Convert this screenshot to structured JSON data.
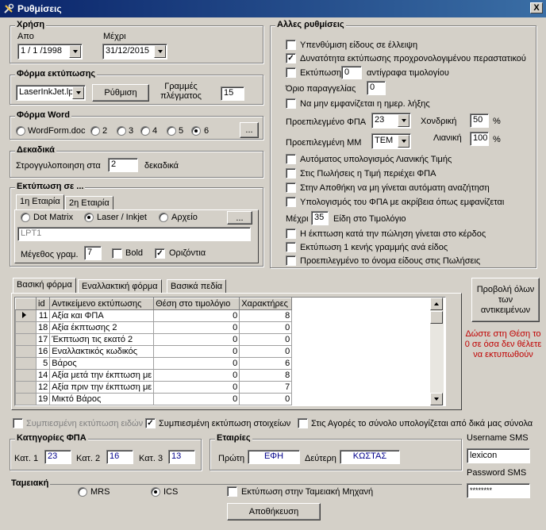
{
  "window": {
    "title": "Ρυθμίσεις",
    "close": "X"
  },
  "xrisi": {
    "title": "Χρήση",
    "from_label": "Απο",
    "to_label": "Μέχρι",
    "from_value": "1 / 1 /1998",
    "to_value": "31/12/2015"
  },
  "print_form": {
    "title": "Φόρμα εκτύπωσης",
    "printer_value": "LaserInkJet.lpi",
    "setup_button": "Ρύθμιση",
    "grid_lines_label": "Γραμμές πλέγματος",
    "grid_lines_value": "15"
  },
  "word_form": {
    "title": "Φόρμα Word",
    "options": [
      "WordForm.doc",
      "2",
      "3",
      "4",
      "5",
      "6"
    ],
    "selected": "6",
    "browse_button": "..."
  },
  "decimals": {
    "title": "Δεκαδικά",
    "round_label": "Στρογγυλοποιηση στα",
    "value": "2",
    "suffix": "δεκαδικά"
  },
  "print_to": {
    "title": "Εκτύπωση σε ...",
    "tabs": [
      "1η Εταιρία",
      "2η Εταιρία"
    ],
    "modes": [
      "Dot Matrix",
      "Laser / Inkjet",
      "Αρχείο"
    ],
    "selected_mode": "Laser / Inkjet",
    "browse_button": "...",
    "port_value": "LPT1",
    "font_size_label": "Μέγεθος γραμ.",
    "font_size_value": "7",
    "bold_label": "Bold",
    "horizontal_label": "Οριζόντια"
  },
  "other": {
    "title": "Αλλες ρυθμίσεις",
    "reminder": "Υπενθύμιση είδους σε έλλειψη",
    "backdated": "Δυνατότητα εκτύπωσης προχρονολογιμένου περαστατικού",
    "print_label": "Εκτύπωση",
    "copies_value": "0",
    "copies_suffix": "αντίγραφα τιμολογίου",
    "order_limit_label": "Όριο παραγγελίας",
    "order_limit_value": "0",
    "hide_due": "Να μην εμφανίζεται η ημερ. λήξης",
    "vat_label": "Προεπιλεγμένο ΦΠΑ",
    "vat_value": "23",
    "wholesale_label": "Χονδρική",
    "wholesale_value": "50",
    "percent": "%",
    "unit_label": "Προεπιλεγμένη ΜΜ",
    "unit_value": "ΤΕΜ",
    "retail_label": "Λιανική",
    "retail_value": "100",
    "auto_retail": "Αυτόματος υπολογισμός Λιανικής Τιμής",
    "sales_vat": "Στις Πωλήσεις η Τιμή περιέχει ΦΠΑ",
    "warehouse_search": "Στην Αποθήκη να μη γίνεται αυτόματη αναζήτηση",
    "vat_exact": "Υπολογισμός του ΦΠΑ με ακρίβεια όπως εμφανίζεται",
    "max_label": "Μέχρι",
    "max_value": "35",
    "max_suffix": "Είδη στο Τιμολόγιο",
    "discount_profit": "Η έκπτωση κατά την πώληση γίνεται στο κέρδος",
    "blank_line": "Εκτύπωση 1 κενής γραμμής ανά είδος",
    "default_name": "Προεπιλεγμένο το όνομα είδους στις Πωλήσεις"
  },
  "form_tabs": [
    "Βασική φόρμα",
    "Εναλλακτική φόρμα",
    "Βασικά πεδία"
  ],
  "table": {
    "headers": [
      "id",
      "Αντικείμενο εκτύπωσης",
      "Θέση στο τιμολόγιο",
      "Χαρακτήρες"
    ],
    "rows": [
      [
        "11",
        "Αξία και ΦΠΑ",
        "0",
        "8"
      ],
      [
        "18",
        "Αξία έκπτωσης 2",
        "0",
        "0"
      ],
      [
        "17",
        "Έκπτωση τις εκατό 2",
        "0",
        "0"
      ],
      [
        "16",
        "Εναλλακτικός κωδικός",
        "0",
        "0"
      ],
      [
        "5",
        "Βάρος",
        "0",
        "6"
      ],
      [
        "14",
        "Αξία μετά την έκπτωση με",
        "0",
        "8"
      ],
      [
        "12",
        "Αξία πριν την έκπτωση με",
        "0",
        "7"
      ],
      [
        "19",
        "Μικτό Βάρος",
        "0",
        "0"
      ]
    ]
  },
  "show_all_button": "Προβολή όλων των αντικειμένων",
  "hint": "Δώστε στη Θέση το 0 σε όσα δεν θέλετε να εκτυπωθούν",
  "bottom": {
    "compressed_items": "Συμπιεσμένη εκτύπωση ειδών",
    "compressed_elements": "Συμπιεσμένη εκτύπωση στοιχείων",
    "purchases": "Στις Αγορές το σύνολο υπολογίζεται  από δικά μας σύνολα"
  },
  "vat_categories": {
    "title": "Κατηγορίες ΦΠΑ",
    "cat1_label": "Κατ. 1",
    "cat1_value": "23",
    "cat2_label": "Κατ. 2",
    "cat2_value": "16",
    "cat3_label": "Κατ. 3",
    "cat3_value": "13"
  },
  "companies": {
    "title": "Εταιρίες",
    "first_label": "Πρώτη",
    "first_value": "ΕΦΗ",
    "second_label": "Δεύτερη",
    "second_value": "ΚΩΣΤΑΣ"
  },
  "sms": {
    "username_label": "Username SMS",
    "username_value": "lexicon",
    "password_label": "Password SMS",
    "password_value": "********"
  },
  "cashier": {
    "title": "Ταμειακή",
    "options": [
      "MRS",
      "ICS"
    ],
    "selected": "ICS",
    "print_label": "Εκτύπωση στην Ταμειακή Μηχανή"
  },
  "save_button": "Αποθήκευση"
}
